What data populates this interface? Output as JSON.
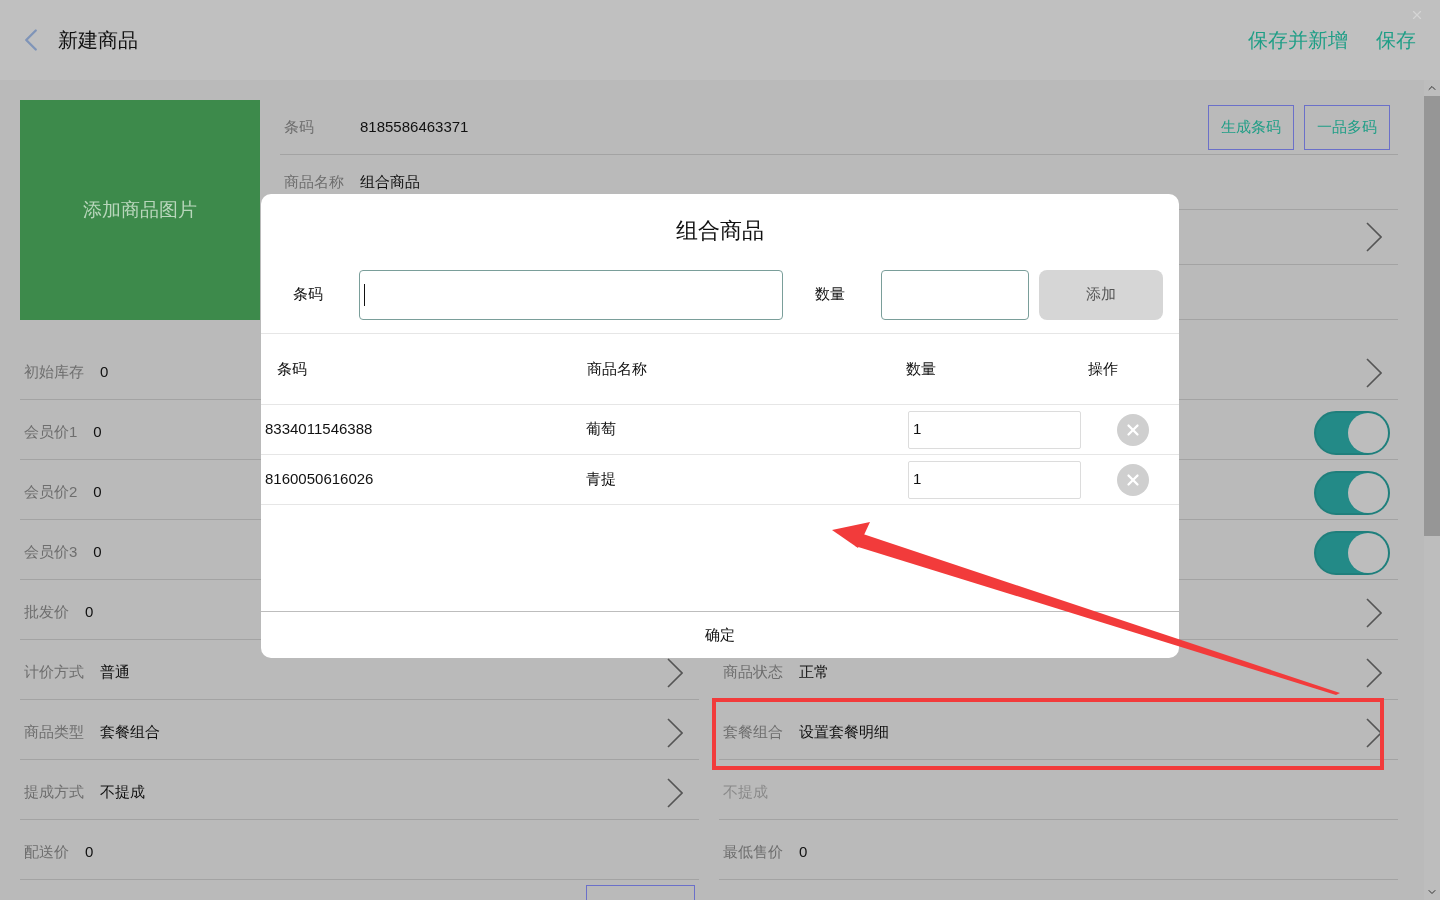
{
  "header": {
    "title": "新建商品",
    "actions": [
      {
        "label": "保存并新增"
      },
      {
        "label": "保存"
      }
    ]
  },
  "image_placeholder": "添加商品图片",
  "top_fields": [
    {
      "kind": "text",
      "label": "条码",
      "value": "8185586463371",
      "buttons": [
        "生成条码",
        "一品多码"
      ]
    },
    {
      "kind": "text",
      "label": "商品名称",
      "value": "组合商品"
    },
    {
      "kind": "select"
    },
    {
      "kind": "blank"
    }
  ],
  "left_rows": [
    {
      "kind": "text",
      "label": "初始库存",
      "value": "0"
    },
    {
      "kind": "text",
      "label": "会员价1",
      "value": "0"
    },
    {
      "kind": "text",
      "label": "会员价2",
      "value": "0"
    },
    {
      "kind": "text",
      "label": "会员价3",
      "value": "0"
    },
    {
      "kind": "text",
      "label": "批发价",
      "value": "0"
    },
    {
      "kind": "select",
      "label": "计价方式",
      "value": "普通"
    },
    {
      "kind": "select",
      "label": "商品类型",
      "value": "套餐组合"
    },
    {
      "kind": "select",
      "label": "提成方式",
      "value": "不提成"
    },
    {
      "kind": "text",
      "label": "配送价",
      "value": "0"
    },
    {
      "kind": "button"
    }
  ],
  "right_rows": [
    {
      "kind": "select"
    },
    {
      "kind": "toggle",
      "on": true
    },
    {
      "kind": "toggle",
      "on": true
    },
    {
      "kind": "toggle",
      "on": true
    },
    {
      "kind": "select"
    },
    {
      "kind": "select",
      "label": "商品状态",
      "value": "正常"
    },
    {
      "kind": "select",
      "label": "套餐组合",
      "value": "设置套餐明细"
    },
    {
      "kind": "text",
      "placeholder": "不提成"
    },
    {
      "kind": "text",
      "label": "最低售价",
      "value": "0"
    }
  ],
  "dialog": {
    "title": "组合商品",
    "barcode_label": "条码",
    "qty_label": "数量",
    "add_button": "添加",
    "columns": [
      "条码",
      "商品名称",
      "数量",
      "操作"
    ],
    "rows": [
      {
        "barcode": "8334011546388",
        "name": "葡萄",
        "qty": "1"
      },
      {
        "barcode": "8160050616026",
        "name": "青提",
        "qty": "1"
      }
    ],
    "confirm": "确定"
  }
}
